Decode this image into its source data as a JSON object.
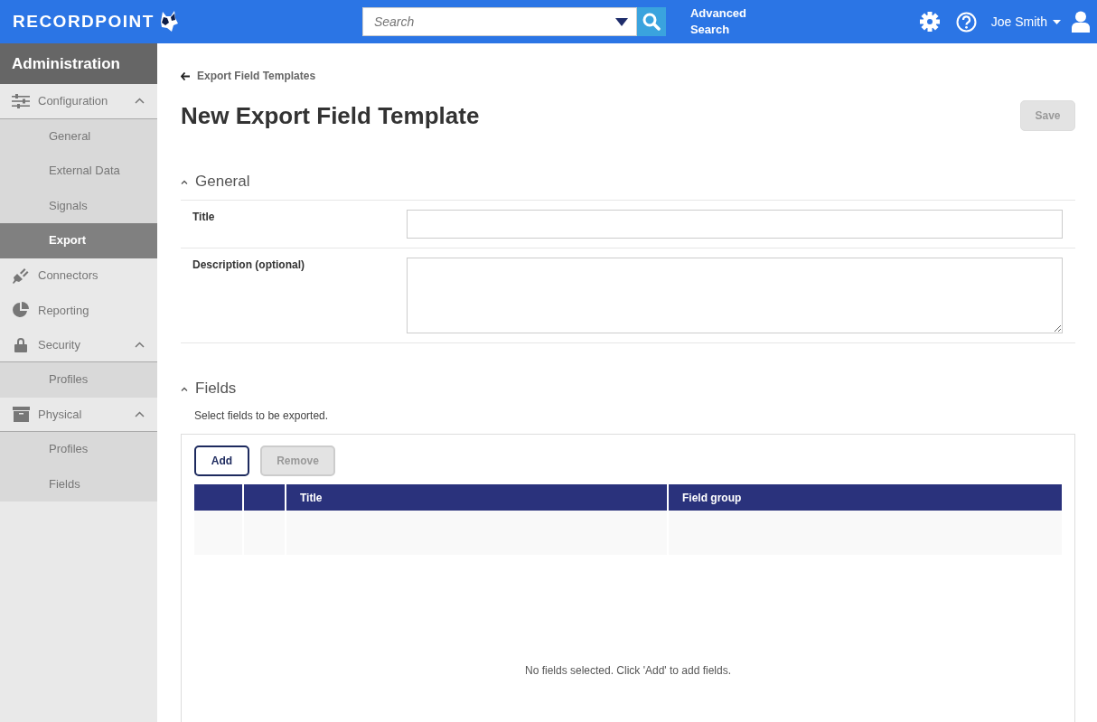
{
  "header": {
    "logo": "RECORDPOINT",
    "search": {
      "placeholder": "Search"
    },
    "advanced_search": "Advanced Search",
    "user": "Joe Smith"
  },
  "sidebar": {
    "title": "Administration",
    "items": [
      {
        "label": "Configuration",
        "expanded": true,
        "children": [
          {
            "label": "General",
            "selected": false
          },
          {
            "label": "External Data",
            "selected": false
          },
          {
            "label": "Signals",
            "selected": false
          },
          {
            "label": "Export",
            "selected": true
          }
        ]
      },
      {
        "label": "Connectors"
      },
      {
        "label": "Reporting"
      },
      {
        "label": "Security",
        "expanded": true,
        "children": [
          {
            "label": "Profiles",
            "selected": false
          }
        ]
      },
      {
        "label": "Physical",
        "expanded": true,
        "children": [
          {
            "label": "Profiles",
            "selected": false
          },
          {
            "label": "Fields",
            "selected": false
          }
        ]
      }
    ]
  },
  "breadcrumb": "Export Field Templates",
  "page_title": "New Export Field Template",
  "save_button": {
    "label": "Save",
    "disabled": true
  },
  "general": {
    "title": "General",
    "expanded": true,
    "fields": [
      {
        "label": "Title",
        "kind": "input"
      },
      {
        "label": "Description (optional)",
        "kind": "textarea"
      }
    ]
  },
  "fields_section": {
    "title": "Fields",
    "expanded": true,
    "hint": "Select fields to be exported.",
    "buttons": [
      {
        "label": "Add",
        "disabled": false
      },
      {
        "label": "Remove",
        "disabled": true
      }
    ],
    "table": {
      "columns": [
        "Title",
        "Field group"
      ],
      "empty_message": "No fields selected. Click 'Add' to add fields."
    }
  }
}
